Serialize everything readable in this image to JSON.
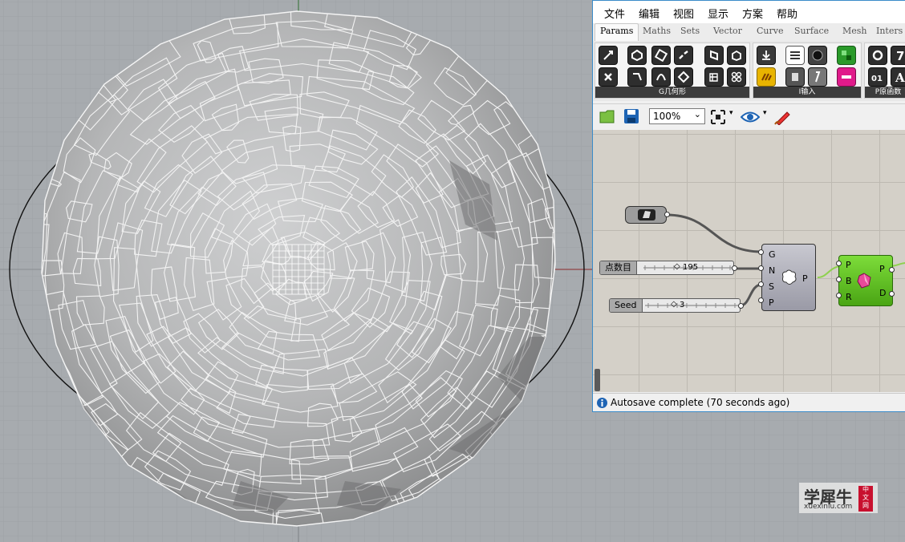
{
  "menu": [
    "文件",
    "编辑",
    "视图",
    "显示",
    "方案",
    "帮助"
  ],
  "tabs": [
    "Params",
    "Maths",
    "Sets",
    "Vector",
    "Curve",
    "Surface",
    "Mesh",
    "Inters"
  ],
  "ribbon": {
    "panel1_label": "G几何形",
    "panel2_label": "I输入",
    "panel3_label": "P原函数"
  },
  "toolbar": {
    "zoom": "100%"
  },
  "canvas": {
    "slider1": {
      "label": "点数目",
      "value": "195"
    },
    "slider2": {
      "label": "Seed",
      "value": "3"
    },
    "populate": {
      "inputs": [
        "G",
        "N",
        "S",
        "P"
      ],
      "output": "P"
    },
    "voronoi": {
      "inputs": [
        "P",
        "B",
        "R"
      ],
      "outputs": [
        "P",
        "D"
      ]
    }
  },
  "status": {
    "text": "Autosave complete (70 seconds ago)"
  },
  "watermark": {
    "main": "学犀牛",
    "sub": "xuexiniu.com",
    "badge": [
      "中",
      "文",
      "网"
    ]
  },
  "colors": {
    "viewport_bg": "#a7abaf",
    "accent": "#3a8bc9",
    "node_green": "#5bbd1a"
  }
}
